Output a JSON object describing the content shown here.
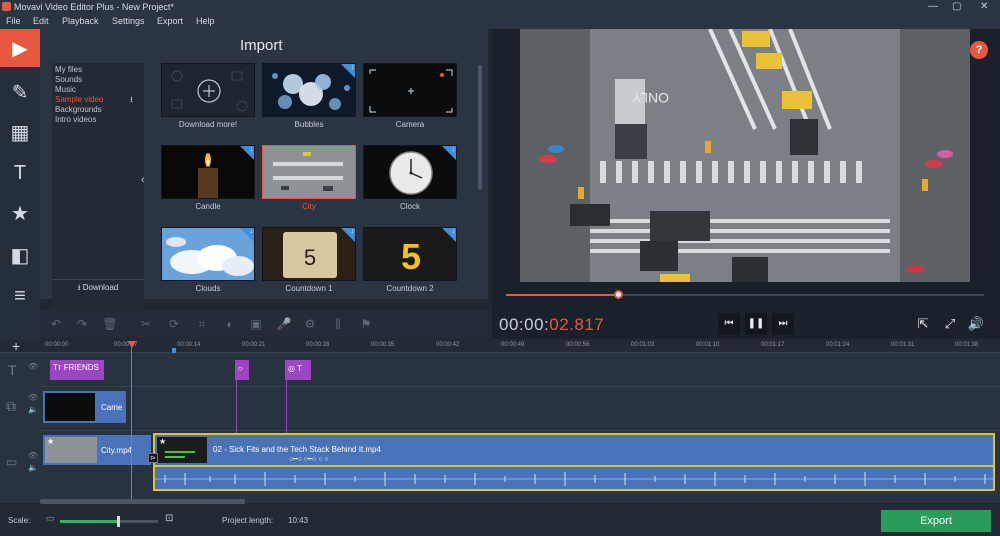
{
  "window": {
    "title": "Movavi Video Editor Plus - New Project*",
    "controls": [
      "—",
      "▢",
      "✕"
    ]
  },
  "menu": [
    "File",
    "Edit",
    "Playback",
    "Settings",
    "Export",
    "Help"
  ],
  "left_tools": [
    {
      "icon": "import-icon",
      "glyph": "▶",
      "active": true
    },
    {
      "icon": "magic-wand-icon",
      "glyph": "✎",
      "active": false
    },
    {
      "icon": "transitions-icon",
      "glyph": "▦",
      "active": false
    },
    {
      "icon": "titles-icon",
      "glyph": "T",
      "active": false
    },
    {
      "icon": "stickers-icon",
      "glyph": "★",
      "active": false
    },
    {
      "icon": "callouts-icon",
      "glyph": "◧",
      "active": false
    },
    {
      "icon": "more-tools-icon",
      "glyph": "≡",
      "active": false
    }
  ],
  "import": {
    "title": "Import",
    "categories": [
      "My files",
      "Sounds",
      "Music",
      "Sample video",
      "Backgrounds",
      "Intro videos"
    ],
    "selected_category": "Sample video",
    "download_label": "Download",
    "thumbs": [
      {
        "label": "Download more!",
        "download": false,
        "selected": false
      },
      {
        "label": "Bubbles",
        "download": true,
        "selected": false
      },
      {
        "label": "Camera",
        "download": false,
        "selected": false
      },
      {
        "label": "Candle",
        "download": true,
        "selected": false
      },
      {
        "label": "City",
        "download": false,
        "selected": true
      },
      {
        "label": "Clock",
        "download": true,
        "selected": false
      },
      {
        "label": "Clouds",
        "download": true,
        "selected": false
      },
      {
        "label": "Countdown 1",
        "download": true,
        "selected": false
      },
      {
        "label": "Countdown 2",
        "download": true,
        "selected": false
      }
    ],
    "countdown1_digit": "5",
    "countdown2_digit": "5"
  },
  "preview": {
    "help": "?",
    "street_text": "ONLY",
    "progress": 0.235
  },
  "timecode": {
    "white": "00:00:",
    "red": "02.817"
  },
  "playback_buttons": [
    "⏮",
    "❚❚",
    "⏭"
  ],
  "right_buttons": [
    "⇱",
    "⤢",
    "🔊"
  ],
  "ruler_ticks": [
    "00:00:00",
    "00:00:07",
    "00:00:14",
    "00:00:21",
    "00:00:28",
    "00:00:35",
    "00:00:42",
    "00:00:49",
    "00:00:56",
    "00:01:03",
    "00:01:10",
    "00:01:17",
    "00:01:24",
    "00:01:31",
    "00:01:38"
  ],
  "timeline": {
    "add_track": "+",
    "title_clip": "Tт FRIENDS",
    "overlay_clip": "Came",
    "video_clip_1": "City.mp4",
    "video_clip_2": "02 - Sick Fits and the Tech Stack Behind It.mp4"
  },
  "bottom": {
    "scale_label": "Scale:",
    "project_length_label": "Project length:",
    "project_length": "10:43",
    "export_label": "Export",
    "scale": 0.6
  }
}
